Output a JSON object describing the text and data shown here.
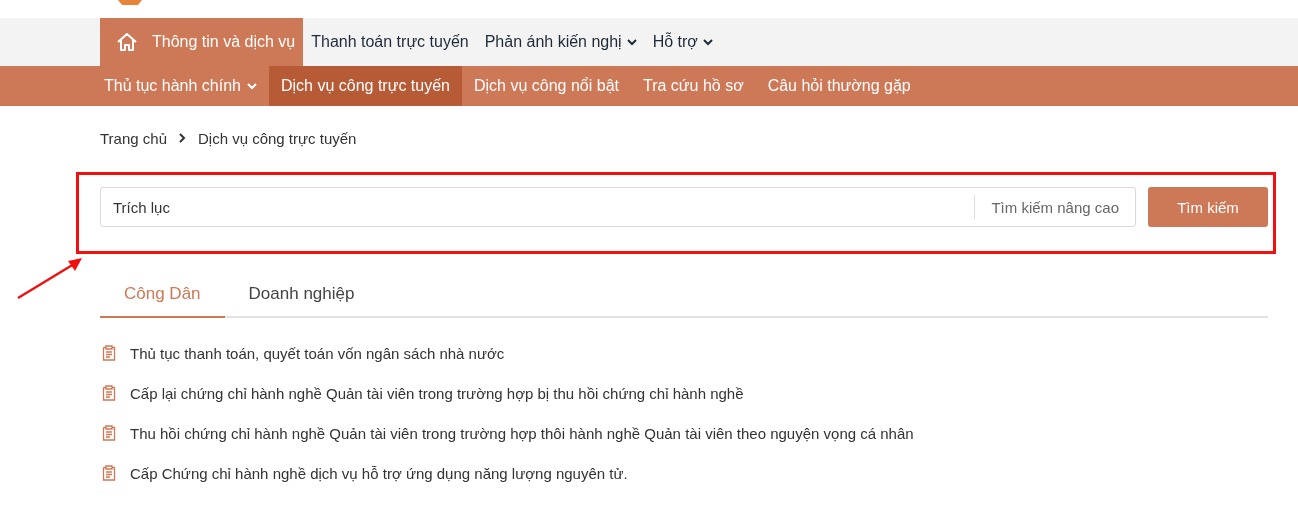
{
  "top_nav": {
    "items": [
      {
        "label": "Thông tin và dịch vụ",
        "selected": true,
        "dropdown": false
      },
      {
        "label": "Thanh toán trực tuyến",
        "selected": false,
        "dropdown": false
      },
      {
        "label": "Phản ánh kiến nghị",
        "selected": false,
        "dropdown": true
      },
      {
        "label": "Hỗ trợ",
        "selected": false,
        "dropdown": true
      }
    ]
  },
  "sub_nav": {
    "items": [
      {
        "label": "Thủ tục hành chính",
        "selected": false,
        "dropdown": true
      },
      {
        "label": "Dịch vụ công trực tuyến",
        "selected": true,
        "dropdown": false
      },
      {
        "label": "Dịch vụ công nổi bật",
        "selected": false,
        "dropdown": false
      },
      {
        "label": "Tra cứu hồ sơ",
        "selected": false,
        "dropdown": false
      },
      {
        "label": "Câu hỏi thường gặp",
        "selected": false,
        "dropdown": false
      }
    ]
  },
  "breadcrumb": [
    "Trang chủ",
    "Dịch vụ công trực tuyến"
  ],
  "search": {
    "value": "Trích lục",
    "advanced_link": "Tìm kiếm nâng cao",
    "button": "Tìm kiếm"
  },
  "tabs": [
    {
      "label": "Công Dân",
      "selected": true
    },
    {
      "label": "Doanh nghiệp",
      "selected": false
    }
  ],
  "procedures": [
    "Thủ tục thanh toán, quyết toán vốn ngân sách nhà nước",
    "Cấp lại chứng chỉ hành nghề Quản tài viên trong trường hợp bị thu hồi chứng chỉ hành nghề",
    "Thu hồi chứng chỉ hành nghề Quản tài viên trong trường hợp thôi hành nghề Quản tài viên theo nguyện vọng cá nhân",
    "Cấp Chứng chỉ hành nghề dịch vụ hỗ trợ ứng dụng năng lượng nguyên tử."
  ]
}
